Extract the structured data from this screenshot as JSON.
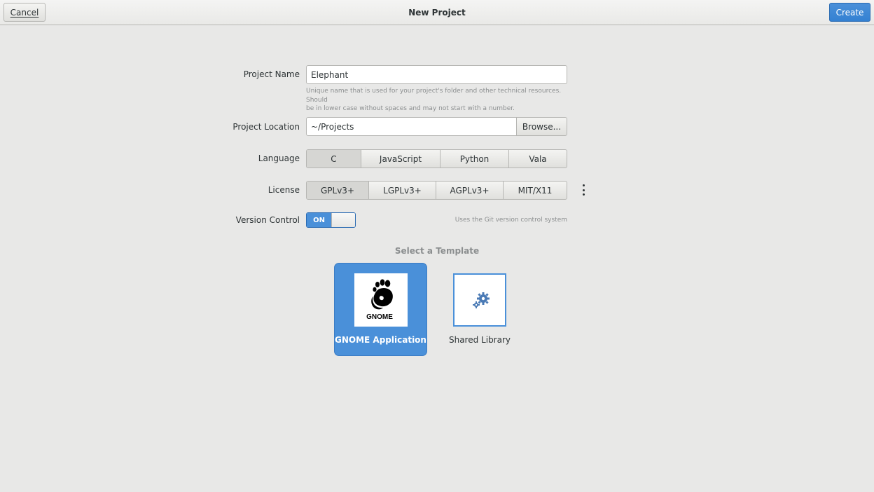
{
  "header": {
    "cancel_label": "Cancel",
    "title": "New Project",
    "create_label": "Create"
  },
  "form": {
    "project_name": {
      "label": "Project Name",
      "value": "Elephant",
      "hint_line1": "Unique name that is used for your project's folder and other technical resources. Should",
      "hint_line2": "be in lower case without spaces and may not start with a number."
    },
    "project_location": {
      "label": "Project Location",
      "value": "~/Projects",
      "browse_label": "Browse..."
    },
    "language": {
      "label": "Language",
      "options": [
        "C",
        "JavaScript",
        "Python",
        "Vala"
      ],
      "selected": "C"
    },
    "license": {
      "label": "License",
      "options": [
        "GPLv3+",
        "LGPLv3+",
        "AGPLv3+",
        "MIT/X11"
      ],
      "selected": "GPLv3+"
    },
    "version_control": {
      "label": "Version Control",
      "state_label": "ON",
      "hint": "Uses the Git version control system"
    }
  },
  "templates": {
    "section_title": "Select a Template",
    "items": [
      {
        "label": "GNOME Application",
        "selected": true,
        "icon": "gnome-foot-logo",
        "logo_text": "GNOME"
      },
      {
        "label": "Shared Library",
        "selected": false,
        "icon": "gears-icon"
      }
    ]
  },
  "colors": {
    "accent": "#4a90d9",
    "background": "#e8e8e7",
    "hint_text": "#8b8e8f"
  }
}
